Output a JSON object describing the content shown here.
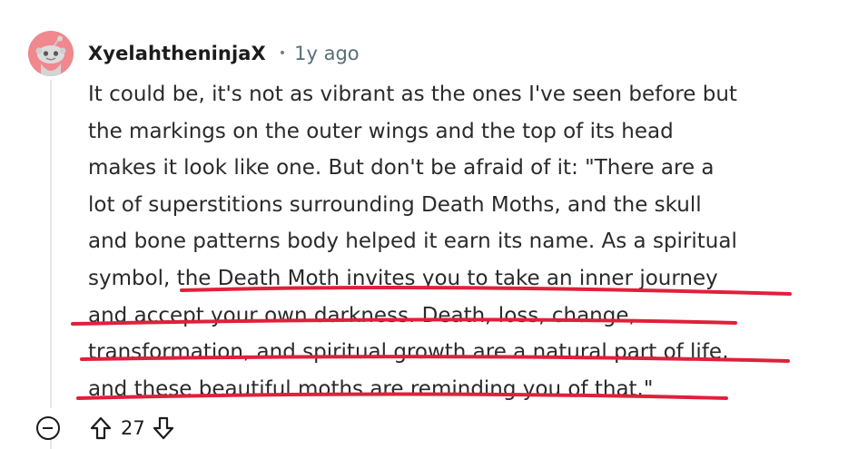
{
  "comment": {
    "author": "XyelahtheninjaX",
    "separator": "•",
    "timestamp": "1y ago",
    "body_lines": [
      "It could be, it's not as vibrant as the ones I've seen before but",
      "the markings on the outer wings and the top of its head",
      "makes it look like one. But don't be afraid of it: \"There are a",
      "lot of superstitions surrounding Death Moths, and the skull",
      "and bone patterns body helped it earn its name. As a spiritual",
      "symbol, the Death Moth invites you to take an inner journey",
      "and accept your own darkness. Death, loss, change,",
      "transformation, and spiritual growth are a natural part of life,",
      "and these beautiful moths are reminding you of that.\""
    ],
    "score": "27"
  },
  "icons": {
    "avatar": "snoo-avatar-icon",
    "collapse": "collapse-minus-icon",
    "upvote": "upvote-arrow-icon",
    "downvote": "downvote-arrow-icon"
  },
  "colors": {
    "avatar_bg": "#f0888e",
    "highlight_underline": "#e0203c",
    "username": "#1c1c1c",
    "timestamp": "#576f76",
    "thread_line": "#e4e6e8"
  }
}
